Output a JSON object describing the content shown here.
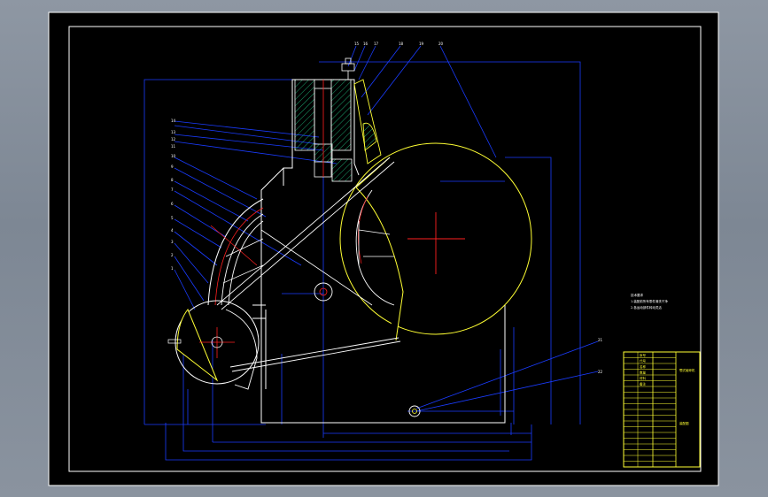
{
  "drawing": {
    "callout_numbers_top": [
      "15",
      "16",
      "17",
      "18",
      "19",
      "20"
    ],
    "callout_numbers_left": [
      "14",
      "13",
      "12",
      "11",
      "10",
      "9",
      "8",
      "7",
      "6",
      "5",
      "4",
      "3",
      "2",
      "1"
    ],
    "callout_numbers_right": [
      "21",
      "22"
    ],
    "notes": {
      "heading": "技术要求",
      "line_1": "1.装配前所有零件清洗干净",
      "line_2": "2.各运动部件转动灵活"
    },
    "title_block": {
      "left_column": [
        "序号",
        "代号",
        "名称",
        "数量",
        "材料",
        "备注",
        "",
        "",
        "",
        "",
        "",
        "",
        "",
        "",
        "",
        "",
        "",
        "",
        "",
        ""
      ],
      "middle_column": [
        "",
        "",
        "",
        "",
        "",
        "",
        "",
        "",
        "",
        "",
        "",
        "",
        "",
        "",
        "",
        "",
        "",
        "",
        "",
        ""
      ],
      "right_top": "颚式破碎机",
      "right_bottom": "装配图"
    },
    "colors": {
      "background": "#000000",
      "frame": "#ffffff",
      "geometry": "#ffffff",
      "dimension": "#1a3cff",
      "yellow": "#ffff33",
      "red": "#ff2020",
      "hatch": "#22cc88"
    }
  }
}
